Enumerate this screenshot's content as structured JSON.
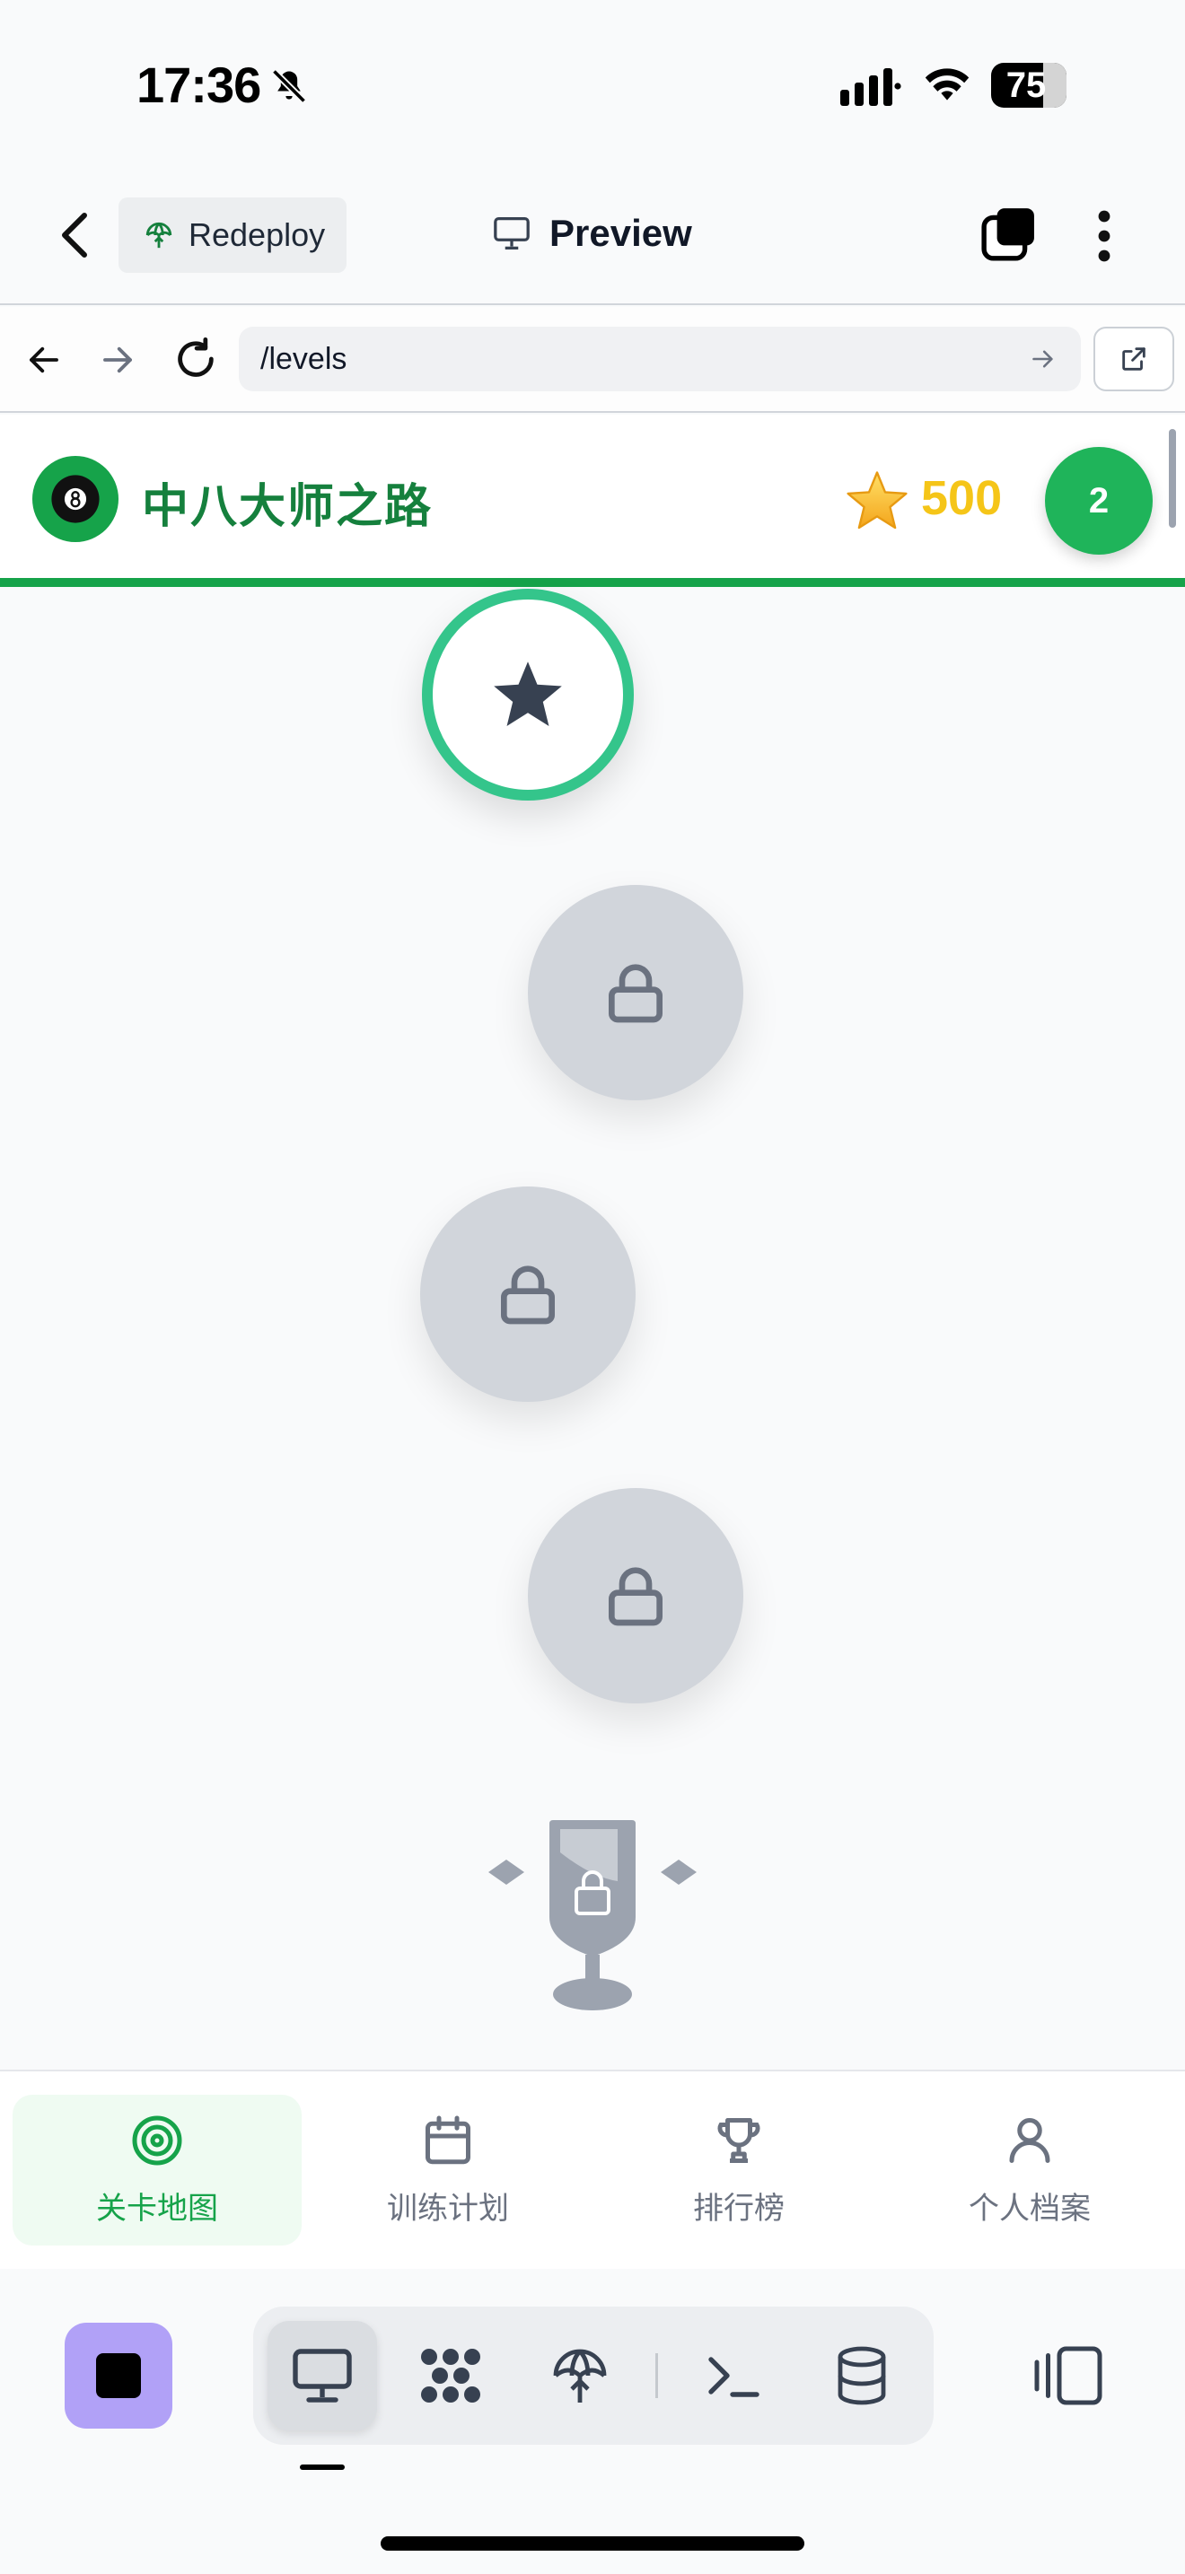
{
  "status_bar": {
    "time": "17:36",
    "battery": "75",
    "icons": [
      "bell-slash-icon",
      "signal-icon",
      "wifi-icon",
      "battery-icon"
    ]
  },
  "topbar": {
    "redeploy_label": "Redeploy",
    "preview_label": "Preview"
  },
  "browser": {
    "url": "/levels"
  },
  "app": {
    "title": "中八大师之路",
    "score": "500",
    "level": "2",
    "accent_color": "#16a34a",
    "score_color": "#f5c518"
  },
  "levels": [
    {
      "state": "current",
      "icon": "star-icon"
    },
    {
      "state": "locked",
      "icon": "lock-icon"
    },
    {
      "state": "locked",
      "icon": "lock-icon"
    },
    {
      "state": "locked",
      "icon": "lock-icon"
    },
    {
      "state": "locked-trophy",
      "icon": "trophy-lock-icon"
    }
  ],
  "bottom_nav": {
    "items": [
      {
        "label": "关卡地图",
        "icon": "target-icon",
        "active": true
      },
      {
        "label": "训练计划",
        "icon": "calendar-icon",
        "active": false
      },
      {
        "label": "排行榜",
        "icon": "trophy-icon",
        "active": false
      },
      {
        "label": "个人档案",
        "icon": "user-icon",
        "active": false
      }
    ]
  },
  "dev_toolbar": {
    "tools": [
      "preview-icon",
      "apps-icon",
      "deploy-icon",
      "terminal-icon",
      "database-icon"
    ],
    "stop_color": "#b1a1f7"
  }
}
